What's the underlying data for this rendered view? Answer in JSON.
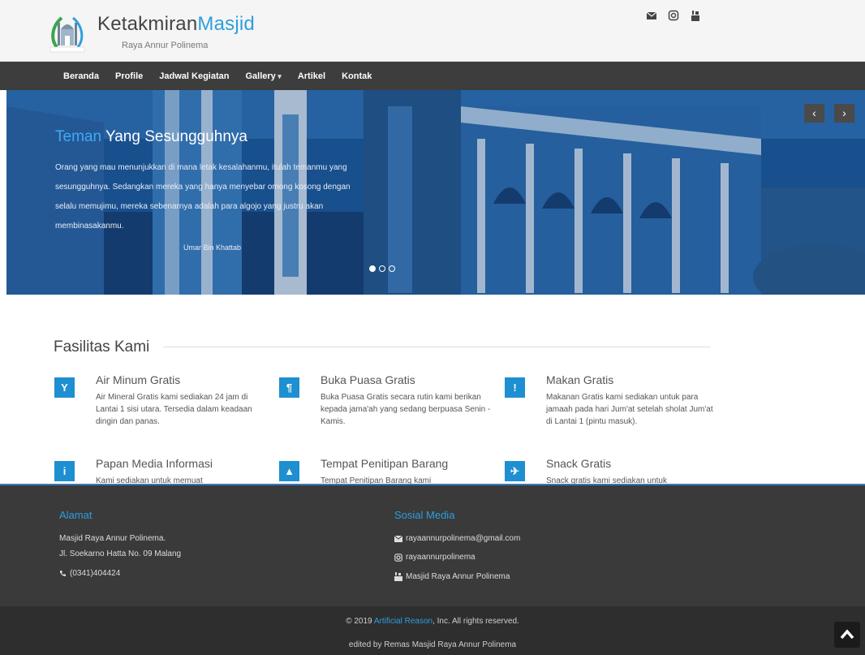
{
  "header": {
    "logo_name_dark": "Ketakmiran",
    "logo_name_accent": "Masjid",
    "subtitle": "Raya Annur Polinema",
    "social_icons": [
      "envelope-icon",
      "instagram-icon",
      "youtube-icon"
    ]
  },
  "nav": {
    "items": [
      {
        "label": "Beranda"
      },
      {
        "label": "Profile"
      },
      {
        "label": "Jadwal Kegiatan"
      },
      {
        "label": "Gallery"
      },
      {
        "label": "Artikel"
      },
      {
        "label": "Kontak"
      }
    ]
  },
  "hero": {
    "title_accent": "Teman",
    "title_rest": " Yang Sesungguhnya",
    "body": "Orang yang mau menunjukkan di mana letak kesalahanmu, itulah temanmu yang sesungguhnya. Sedangkan mereka yang hanya menyebar omong kosong dengan selalu memujimu, mereka sebenarnya adalah para algojo yang justru akan membinasakanmu.",
    "author": "Umar Bin Khattab",
    "prev_label": "‹",
    "next_label": "›",
    "slide_count": 3,
    "active_slide": 1
  },
  "facilities": {
    "heading": "Fasilitas Kami",
    "items": [
      {
        "icon": "glass-icon",
        "glyph": "Y",
        "title": "Air Minum Gratis",
        "desc": "Air Mineral Gratis kami sediakan 24 jam di Lantai 1 sisi utara. Tersedia dalam keadaan dingin dan panas."
      },
      {
        "icon": "cutlery-icon",
        "glyph": "¶",
        "title": "Buka Puasa Gratis",
        "desc": "Buka Puasa Gratis secara rutin kami berikan kepada jama'ah yang sedang berpuasa Senin - Kamis."
      },
      {
        "icon": "exclamation-icon",
        "glyph": "!",
        "title": "Makan Gratis",
        "desc": "Makanan Gratis kami sediakan untuk para jamaah pada hari Jum'at setelah sholat Jum'at di Lantai 1 (pintu masuk)."
      },
      {
        "icon": "info-icon",
        "glyph": "i",
        "title": "Papan Media Informasi",
        "desc": "Kami sediakan untuk memuat"
      },
      {
        "icon": "lock-icon",
        "glyph": "▲",
        "title": "Tempat Penitipan Barang",
        "desc": "Tempat Penitipan Barang kami"
      },
      {
        "icon": "paper-plane-icon",
        "glyph": "✈",
        "title": "Snack Gratis",
        "desc": "Snack gratis kami sediakan untuk"
      }
    ]
  },
  "footer": {
    "address_heading": "Alamat",
    "address_line1": "Masjid Raya Annur Polinema.",
    "address_line2": "Jl. Soekarno Hatta No. 09 Malang",
    "phone": "(0341)404424",
    "social_heading": "Sosial Media",
    "email": "rayaannurpolinema@gmail.com",
    "instagram": "rayaannurpolinema",
    "youtube": "Masjid Raya Annur Polinema"
  },
  "bottom": {
    "copy_prefix": "© 2019 ",
    "copy_link": "Artificial Reason",
    "copy_suffix": ", Inc. All rights reserved.",
    "edited": "edited by Remas Masjid Raya Annur Polinema"
  },
  "colors": {
    "accent": "#2c9fe0",
    "nav_bg": "#3d3d3d",
    "footer_bg": "#3a3a3a",
    "icon_bg": "#1e8fd0"
  }
}
